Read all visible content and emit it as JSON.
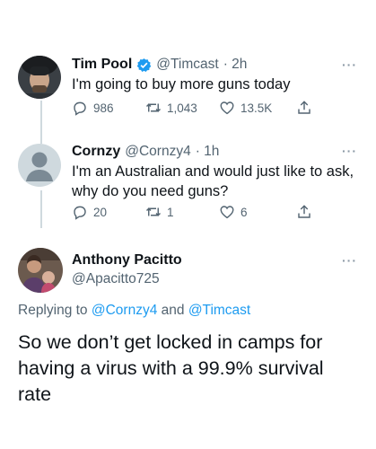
{
  "tweets": [
    {
      "name": "Tim Pool",
      "handle": "@Timcast",
      "time": "· 2h",
      "text": "I'm going to buy more guns today",
      "replies": "986",
      "retweets": "1,043",
      "likes": "13.5K",
      "verified": true
    },
    {
      "name": "Cornzy",
      "handle": "@Cornzy4",
      "time": "· 1h",
      "text_line1": "I'm an Australian and would just like to ask,",
      "text_line2": "why do you need guns?",
      "replies": "20",
      "retweets": "1",
      "likes": "6"
    }
  ],
  "main_tweet": {
    "name": "Anthony Pacitto",
    "handle": "@Apacitto725",
    "replying_prefix": "Replying to",
    "replying_user1": "@Cornzy4",
    "replying_and": "and",
    "replying_user2": "@Timcast",
    "text_line1": "So we don’t get locked in camps for",
    "text_line2": "having a virus with a 99.9% survival",
    "text_line3": "rate"
  },
  "more_glyph": "···",
  "colors": {
    "accent": "#1d9bf0",
    "muted": "#536471",
    "text": "#0f1419",
    "thread_line": "#cfd9de"
  }
}
